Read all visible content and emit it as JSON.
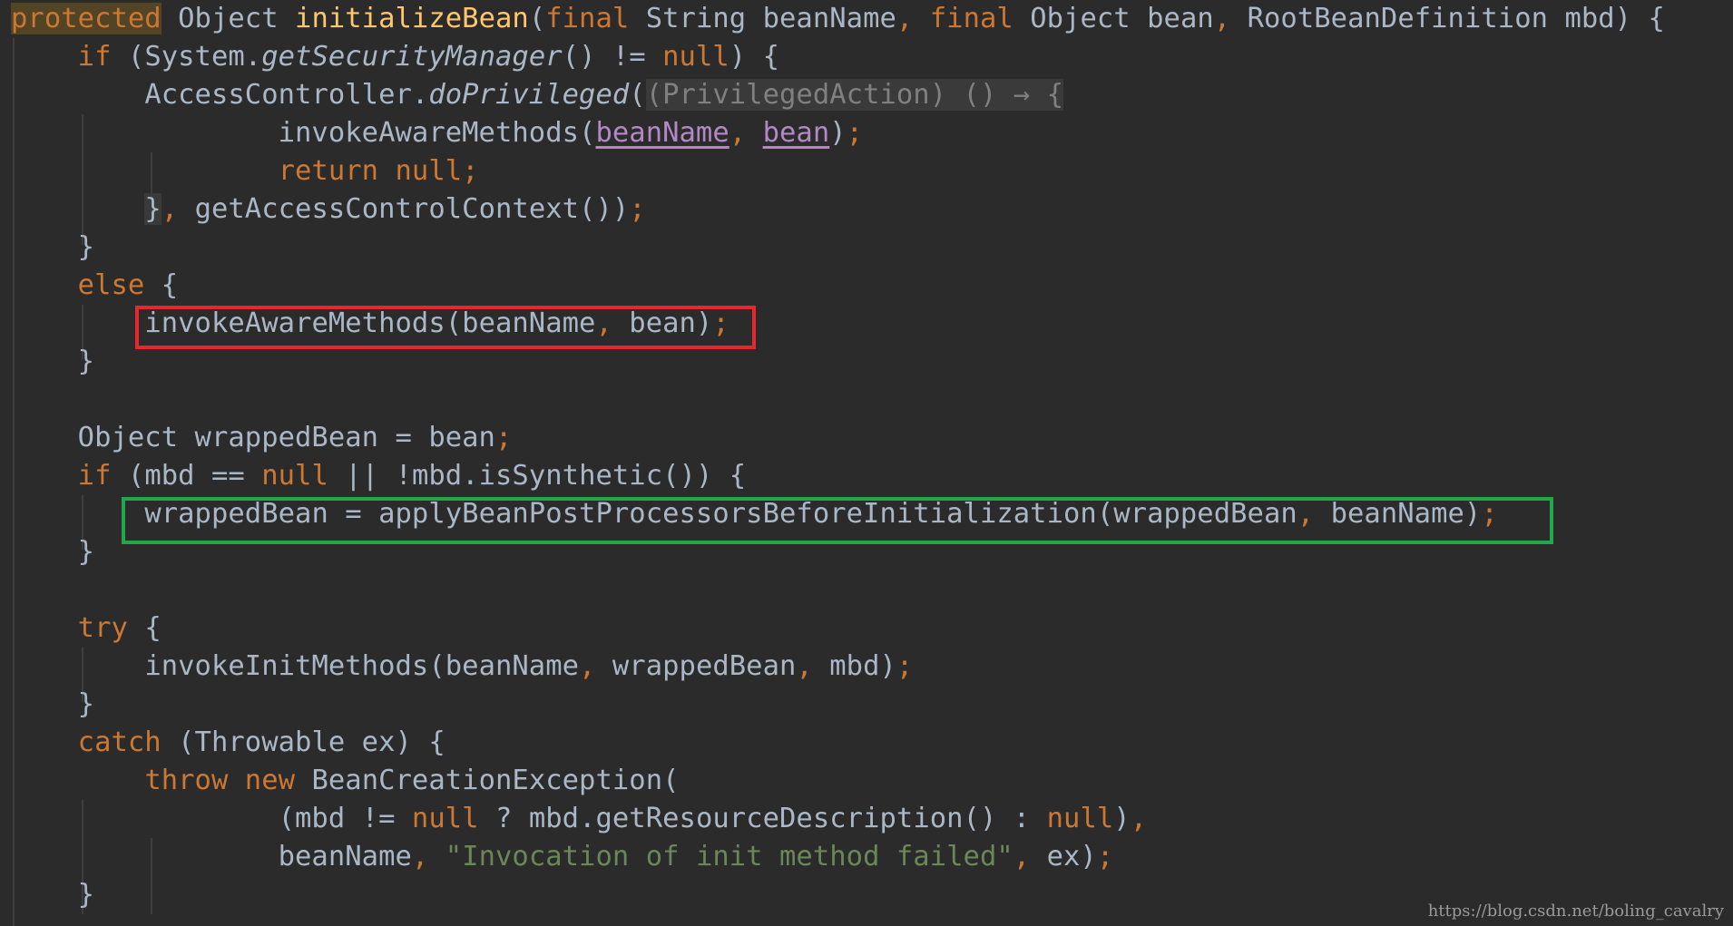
{
  "code": {
    "lines": [
      [
        [
          "protected",
          "highlight"
        ],
        [
          " ",
          "default"
        ],
        [
          "Object ",
          "default"
        ],
        [
          "initializeBean",
          "method"
        ],
        [
          "(",
          "default"
        ],
        [
          "final ",
          "keyword"
        ],
        [
          "String beanName",
          "default"
        ],
        [
          ", ",
          "punct"
        ],
        [
          "final ",
          "keyword"
        ],
        [
          "Object bean",
          "default"
        ],
        [
          ", ",
          "punct"
        ],
        [
          "RootBeanDefinition mbd) {",
          "default"
        ]
      ],
      [
        [
          "    ",
          "default"
        ],
        [
          "if ",
          "keyword"
        ],
        [
          "(System.",
          "default"
        ],
        [
          "getSecurityManager",
          "static"
        ],
        [
          "() != ",
          "default"
        ],
        [
          "null",
          "keyword"
        ],
        [
          ") {",
          "default"
        ]
      ],
      [
        [
          "        ",
          "default"
        ],
        [
          "AccessController.",
          "default"
        ],
        [
          "doPrivileged",
          "static"
        ],
        [
          "(",
          "default"
        ],
        [
          "(PrivilegedAction) () → {",
          "fold"
        ]
      ],
      [
        [
          "                ",
          "default"
        ],
        [
          "invokeAwareMethods(",
          "default"
        ],
        [
          "beanName",
          "param"
        ],
        [
          ", ",
          "punct"
        ],
        [
          "bean",
          "param"
        ],
        [
          ")",
          "default"
        ],
        [
          ";",
          "punct"
        ]
      ],
      [
        [
          "                ",
          "default"
        ],
        [
          "return null",
          "keyword"
        ],
        [
          ";",
          "punct"
        ]
      ],
      [
        [
          "        ",
          "default"
        ],
        [
          "}",
          "foldend"
        ],
        [
          ", ",
          "punct"
        ],
        [
          "getAccessControlContext())",
          "default"
        ],
        [
          ";",
          "punct"
        ]
      ],
      [
        [
          "    }",
          "default"
        ]
      ],
      [
        [
          "    ",
          "default"
        ],
        [
          "else ",
          "keyword"
        ],
        [
          "{",
          "default"
        ]
      ],
      [
        [
          "        ",
          "default"
        ],
        [
          "invokeAwareMethods(beanName",
          "default"
        ],
        [
          ", ",
          "punct"
        ],
        [
          "bean)",
          "default"
        ],
        [
          ";",
          "punct"
        ]
      ],
      [
        [
          "    }",
          "default"
        ]
      ],
      [
        [
          "",
          "default"
        ]
      ],
      [
        [
          "    ",
          "default"
        ],
        [
          "Object wrappedBean = bean",
          "default"
        ],
        [
          ";",
          "punct"
        ]
      ],
      [
        [
          "    ",
          "default"
        ],
        [
          "if ",
          "keyword"
        ],
        [
          "(mbd == ",
          "default"
        ],
        [
          "null ",
          "keyword"
        ],
        [
          "|| !mbd.isSynthetic()) {",
          "default"
        ]
      ],
      [
        [
          "        ",
          "default"
        ],
        [
          "wrappedBean = applyBeanPostProcessorsBeforeInitialization(wrappedBean",
          "default"
        ],
        [
          ", ",
          "punct"
        ],
        [
          "beanName)",
          "default"
        ],
        [
          ";",
          "punct"
        ]
      ],
      [
        [
          "    }",
          "default"
        ]
      ],
      [
        [
          "",
          "default"
        ]
      ],
      [
        [
          "    ",
          "default"
        ],
        [
          "try ",
          "keyword"
        ],
        [
          "{",
          "default"
        ]
      ],
      [
        [
          "        ",
          "default"
        ],
        [
          "invokeInitMethods(beanName",
          "default"
        ],
        [
          ", ",
          "punct"
        ],
        [
          "wrappedBean",
          "default"
        ],
        [
          ", ",
          "punct"
        ],
        [
          "mbd)",
          "default"
        ],
        [
          ";",
          "punct"
        ]
      ],
      [
        [
          "    }",
          "default"
        ]
      ],
      [
        [
          "    ",
          "default"
        ],
        [
          "catch ",
          "keyword"
        ],
        [
          "(Throwable ex) {",
          "default"
        ]
      ],
      [
        [
          "        ",
          "default"
        ],
        [
          "throw new ",
          "keyword"
        ],
        [
          "BeanCreationException(",
          "default"
        ]
      ],
      [
        [
          "                ",
          "default"
        ],
        [
          "(mbd != ",
          "default"
        ],
        [
          "null ",
          "keyword"
        ],
        [
          "? mbd.getResourceDescription() : ",
          "default"
        ],
        [
          "null",
          "keyword"
        ],
        [
          ")",
          "default"
        ],
        [
          ",",
          "punct"
        ]
      ],
      [
        [
          "                ",
          "default"
        ],
        [
          "beanName",
          "default"
        ],
        [
          ", ",
          "punct"
        ],
        [
          "\"Invocation of init method failed\"",
          "string"
        ],
        [
          ", ",
          "punct"
        ],
        [
          "ex)",
          "default"
        ],
        [
          ";",
          "punct"
        ]
      ],
      [
        [
          "    }",
          "default"
        ]
      ]
    ]
  },
  "colors": {
    "background": "#2b2b2b",
    "keyword": "#cc7832",
    "method_declaration": "#ffc66d",
    "identifier": "#a9b7c6",
    "string": "#6a8759",
    "parameter": "#b389c5",
    "red_box": "#e8262b",
    "green_box": "#21a84a"
  },
  "watermark": "https://blog.csdn.net/boling_cavalry"
}
